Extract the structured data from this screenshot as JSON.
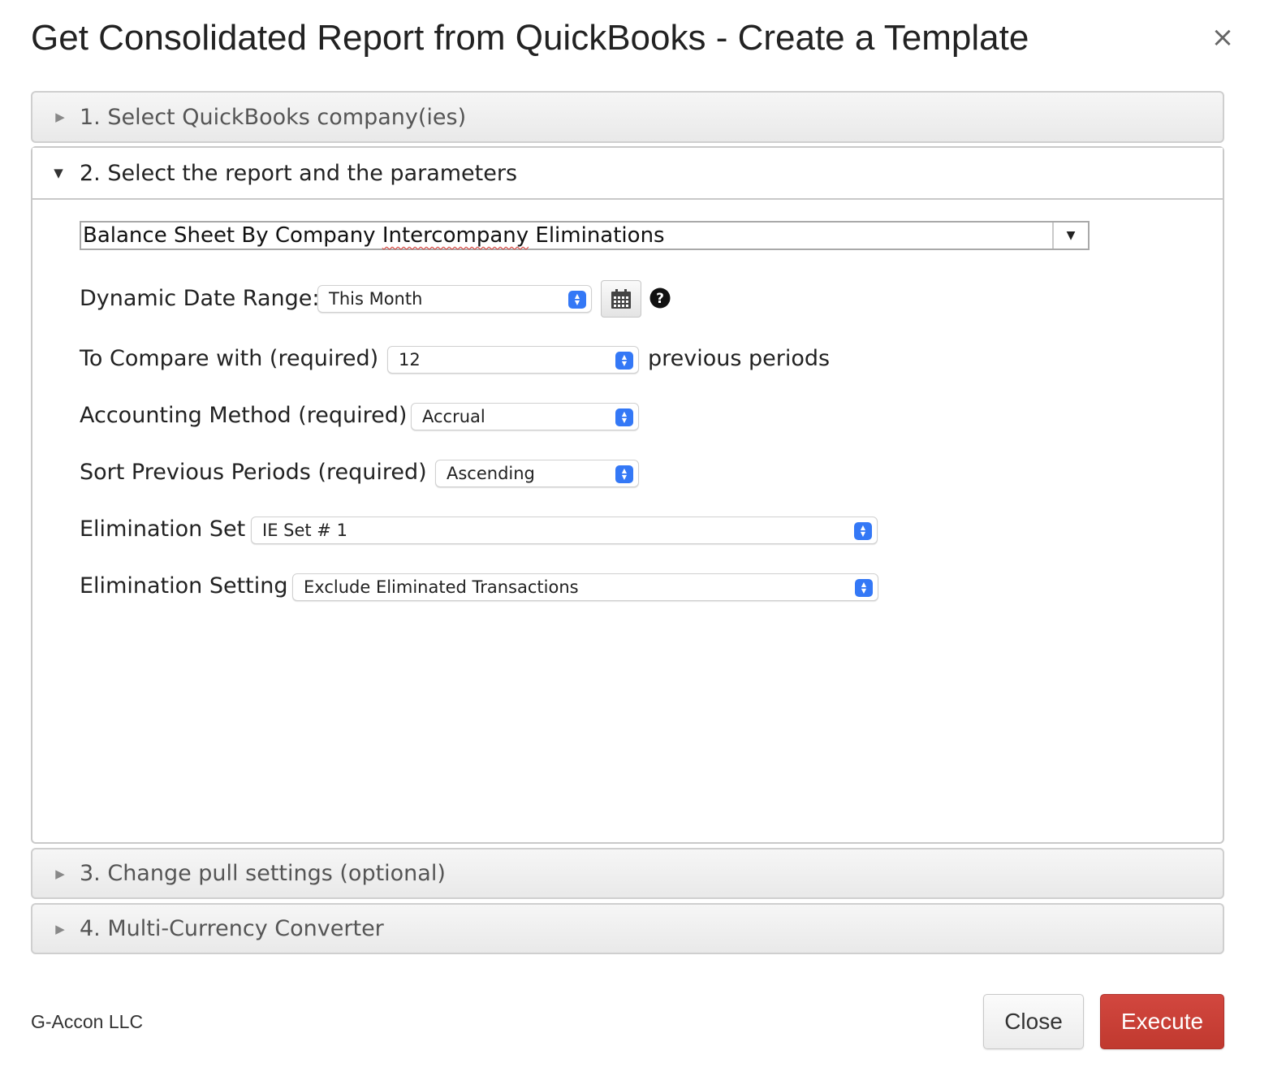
{
  "dialog": {
    "title": "Get Consolidated Report from QuickBooks - Create a Template",
    "close_glyph": "×"
  },
  "sections": [
    {
      "label": "1. Select QuickBooks company(ies)",
      "expanded": false
    },
    {
      "label": "2. Select the report and the parameters",
      "expanded": true
    },
    {
      "label": "3. Change pull settings (optional)",
      "expanded": false
    },
    {
      "label": "4. Multi-Currency Converter",
      "expanded": false
    }
  ],
  "report": {
    "prefix": "Balance Sheet By Company ",
    "misspelled": "Intercompany",
    "suffix": " Eliminations"
  },
  "params": {
    "date_range": {
      "label": "Dynamic Date Range:",
      "value": "This Month"
    },
    "compare": {
      "label": "To Compare with (required)",
      "value": "12",
      "suffix": "previous periods"
    },
    "method": {
      "label": "Accounting Method (required)",
      "value": "Accrual"
    },
    "sort": {
      "label": "Sort Previous Periods (required)",
      "value": "Ascending"
    },
    "elim_set": {
      "label": "Elimination Set",
      "value": "IE Set # 1"
    },
    "elim_setting": {
      "label": "Elimination Setting",
      "value": "Exclude Eliminated Transactions"
    }
  },
  "icons": {
    "calendar": "calendar-icon",
    "help": "help-icon",
    "stepper": "select-stepper-icon"
  },
  "colors": {
    "stepper": "#3478f6",
    "execute": "#c9403a"
  },
  "footer": {
    "brand": "G-Accon LLC",
    "close_label": "Close",
    "execute_label": "Execute"
  }
}
